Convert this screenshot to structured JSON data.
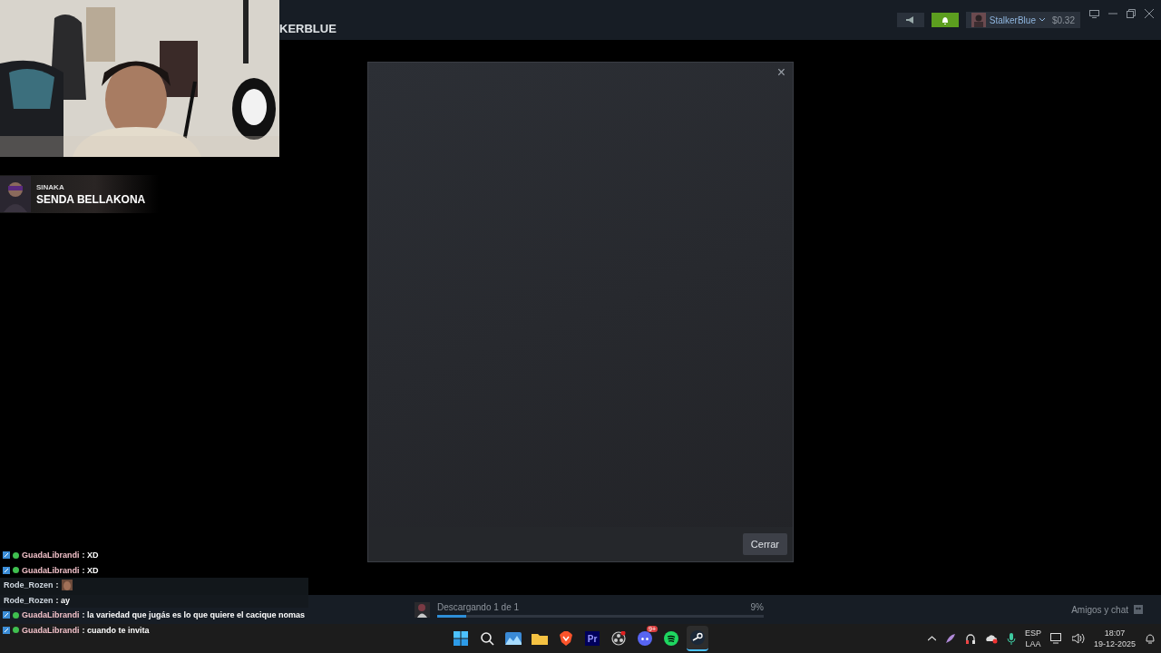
{
  "top_bar": {
    "title": "KERBLUE",
    "account": {
      "name": "StalkerBlue",
      "balance": "$0.32"
    },
    "notifications_on": true
  },
  "dialog": {
    "close_label": "×",
    "button": "Cerrar"
  },
  "now_playing": {
    "artist": "SINAKA",
    "track": "SENDA BELLAKONA"
  },
  "bottom_bar": {
    "download": {
      "label": "Descargando 1 de 1",
      "level": 0.09,
      "percent": "9%"
    },
    "friends": "Amigos y chat"
  },
  "chat": [
    {
      "kind": "badged",
      "user": "GuadaLibrandi",
      "text": ": XD"
    },
    {
      "kind": "badged",
      "user": "GuadaLibrandi",
      "text": ": XD"
    },
    {
      "kind": "emote",
      "user": "Rode_Rozen",
      "text": ":"
    },
    {
      "kind": "plain",
      "user": "Rode_Rozen",
      "text": ": ay"
    },
    {
      "kind": "badged",
      "user": "GuadaLibrandi",
      "text": ": la variedad que jugás es lo que quiere el cacique nomas"
    },
    {
      "kind": "badged",
      "user": "GuadaLibrandi",
      "text": ": cuando te invita"
    }
  ],
  "taskbar": {
    "apps": [
      {
        "kind": "start",
        "selected": false
      },
      {
        "kind": "search",
        "selected": false
      },
      {
        "kind": "photos",
        "selected": false
      },
      {
        "kind": "folder",
        "selected": false
      },
      {
        "kind": "brave",
        "selected": false
      },
      {
        "kind": "premiere",
        "label": "Pr",
        "selected": false
      },
      {
        "kind": "obs",
        "selected": false
      },
      {
        "kind": "discord",
        "badge": "9+",
        "selected": false
      },
      {
        "kind": "spotify",
        "selected": false
      },
      {
        "kind": "steam",
        "selected": true
      }
    ],
    "lang": "ESP",
    "layout": "LAA",
    "time": "18:07",
    "date": "19-12-2025"
  }
}
